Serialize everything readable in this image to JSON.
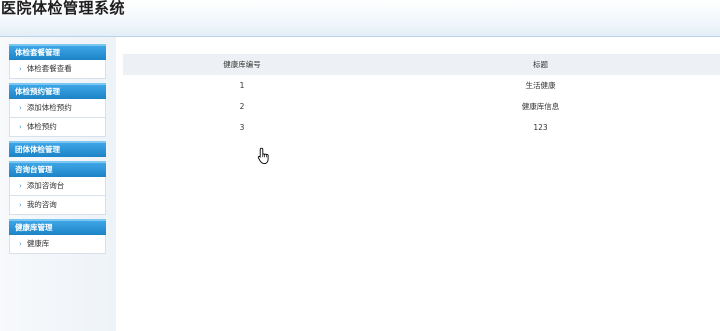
{
  "app": {
    "title": "医院体检管理系统"
  },
  "sidebar": {
    "groups": [
      {
        "header": "体检套餐管理",
        "items": [
          "体检套餐查看"
        ]
      },
      {
        "header": "体检预约管理",
        "items": [
          "添加体检预约",
          "体检预约"
        ]
      },
      {
        "header": "团体体检管理",
        "items": []
      },
      {
        "header": "咨询台管理",
        "items": [
          "添加咨询台",
          "我的咨询"
        ]
      },
      {
        "header": "健康库管理",
        "items": [
          "健康库"
        ]
      }
    ]
  },
  "table": {
    "columns": [
      "健康库编号",
      "标题"
    ],
    "rows": [
      {
        "id": "1",
        "title": "生活健康"
      },
      {
        "id": "2",
        "title": "健康库信息"
      },
      {
        "id": "3",
        "title": "123"
      }
    ]
  },
  "colors": {
    "menu_header": "#1c84c6",
    "header_border": "#b9d3ea",
    "table_header_bg": "#edf1f5"
  },
  "icons": {
    "chevron": "chevron-right-icon",
    "cursor": "hand-pointer-icon"
  }
}
